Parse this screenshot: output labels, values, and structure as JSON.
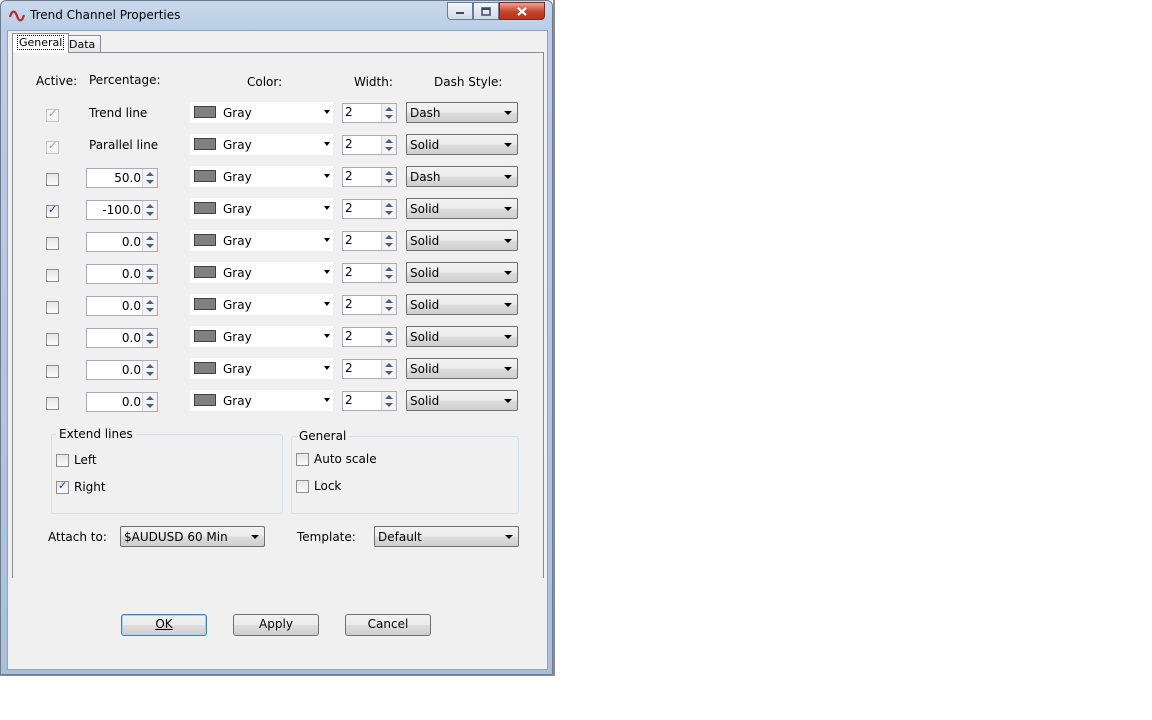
{
  "window": {
    "title": "Trend Channel Properties"
  },
  "tabs": [
    {
      "label": "General"
    },
    {
      "label": "Data"
    }
  ],
  "headers": {
    "active": "Active:",
    "percentage": "Percentage:",
    "color": "Color:",
    "width": "Width:",
    "dash_style": "Dash Style:"
  },
  "rows": [
    {
      "active": true,
      "disabled": true,
      "label": "Trend line",
      "color": "Gray",
      "width": "2",
      "dash": "Dash"
    },
    {
      "active": true,
      "disabled": true,
      "label": "Parallel line",
      "color": "Gray",
      "width": "2",
      "dash": "Solid"
    },
    {
      "active": false,
      "percentage": "50.0",
      "color": "Gray",
      "width": "2",
      "dash": "Dash"
    },
    {
      "active": true,
      "percentage": "-100.0",
      "color": "Gray",
      "width": "2",
      "dash": "Solid"
    },
    {
      "active": false,
      "percentage": "0.0",
      "color": "Gray",
      "width": "2",
      "dash": "Solid"
    },
    {
      "active": false,
      "percentage": "0.0",
      "color": "Gray",
      "width": "2",
      "dash": "Solid"
    },
    {
      "active": false,
      "percentage": "0.0",
      "color": "Gray",
      "width": "2",
      "dash": "Solid"
    },
    {
      "active": false,
      "percentage": "0.0",
      "color": "Gray",
      "width": "2",
      "dash": "Solid"
    },
    {
      "active": false,
      "percentage": "0.0",
      "color": "Gray",
      "width": "2",
      "dash": "Solid"
    },
    {
      "active": false,
      "percentage": "0.0",
      "color": "Gray",
      "width": "2",
      "dash": "Solid"
    }
  ],
  "extend_lines": {
    "title": "Extend lines",
    "left": {
      "label": "Left",
      "checked": false
    },
    "right": {
      "label": "Right",
      "checked": true
    }
  },
  "general_group": {
    "title": "General",
    "auto_scale": {
      "label": "Auto scale",
      "checked": false
    },
    "lock": {
      "label": "Lock",
      "checked": false
    }
  },
  "attach_to": {
    "label": "Attach to:",
    "value": "$AUDUSD 60 Min"
  },
  "template": {
    "label": "Template:",
    "value": "Default"
  },
  "buttons": {
    "ok": "OK",
    "apply": "Apply",
    "cancel": "Cancel"
  },
  "colors": {
    "swatch_gray": "#808080",
    "title_bar": "#b9cde6",
    "close_button": "#c7412b",
    "dialog_bg": "#f0f0f0"
  }
}
